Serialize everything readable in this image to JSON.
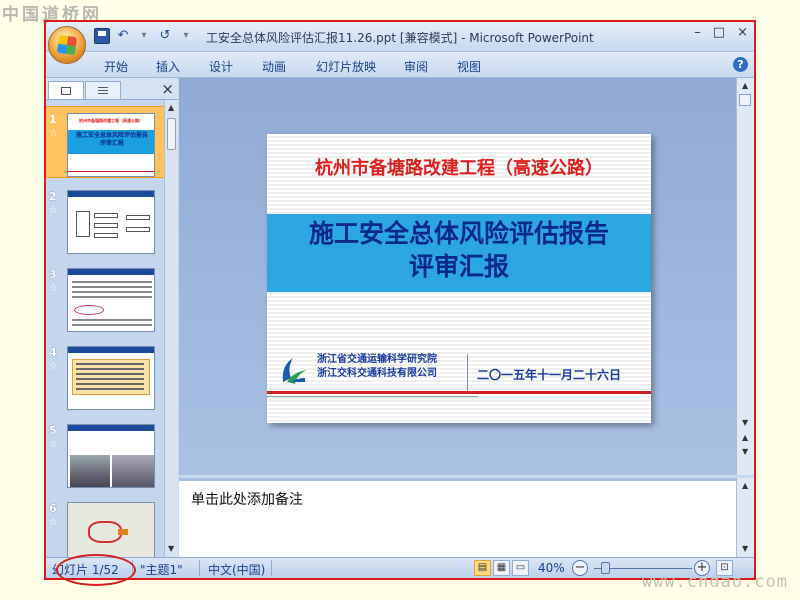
{
  "watermark_top": "中国道桥网",
  "watermark_bottom": "www.cndao.com",
  "window": {
    "title": "工安全总体风险评估汇报11.26.ppt [兼容模式] - Microsoft PowerPoint",
    "qat": {
      "save": "save-icon",
      "undo": "↶",
      "undo_more": "▾",
      "redo": "↺",
      "customize": "▾"
    },
    "controls": [
      "–",
      "□",
      "×"
    ]
  },
  "ribbon": {
    "tabs": [
      "开始",
      "插入",
      "设计",
      "动画",
      "幻灯片放映",
      "审阅",
      "视图"
    ],
    "help": "?"
  },
  "pane": {
    "close": "×",
    "slides": [
      {
        "num": "1",
        "star": "☆"
      },
      {
        "num": "2",
        "star": "☆"
      },
      {
        "num": "3",
        "star": "☆"
      },
      {
        "num": "4",
        "star": "☆"
      },
      {
        "num": "5",
        "star": "☆"
      },
      {
        "num": "6",
        "star": "☆"
      }
    ]
  },
  "slide": {
    "subtitle": "杭州市备塘路改建工程（高速公路）",
    "title_line1": "施工安全总体风险评估报告",
    "title_line2": "评审汇报",
    "org_line1": "浙江省交通运输科学研究院",
    "org_line2": "浙江交科交通科技有限公司",
    "date": "二〇一五年十一月二十六日"
  },
  "thumb1": {
    "subtitle": "杭州市备塘路改建工程（高速公路）",
    "title": "施工安全总体风险评估报告评审汇报"
  },
  "notes": {
    "placeholder": "单击此处添加备注"
  },
  "status": {
    "slide_counter": "幻灯片 1/52",
    "theme": "\"主题1\"",
    "language": "中文(中国)",
    "zoom": "40%",
    "zoom_level_percent": 40
  },
  "colors": {
    "frame": "#e01818",
    "slide_band": "#1aa0e0",
    "slide_title": "#0a2a8a",
    "slide_subtitle": "#e02020",
    "selected_thumb": "#ffc25e"
  }
}
